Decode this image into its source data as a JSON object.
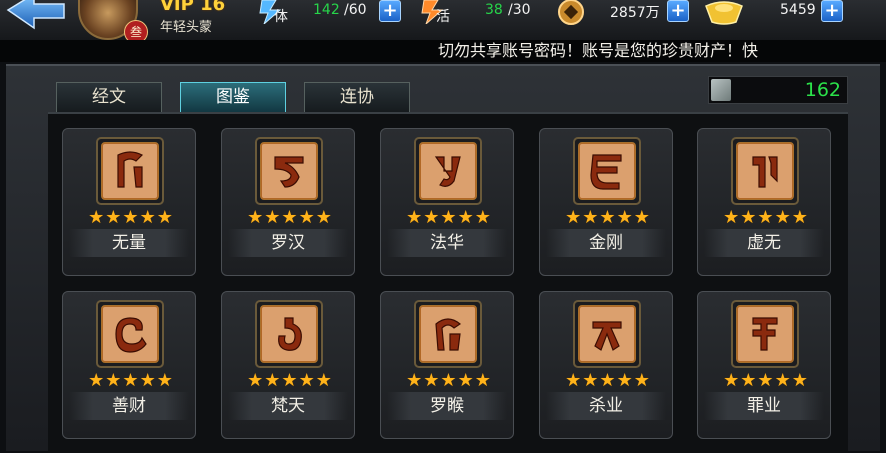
{
  "player": {
    "vip": "VIP 16",
    "title": "年轻头蒙",
    "rank_badge": "叁"
  },
  "resources": {
    "stamina_label": "体",
    "stamina": "142",
    "stamina_max": "/60",
    "vitality_label": "活",
    "vitality": "38",
    "vitality_max": "/30",
    "coins": "2857万",
    "gold": "5459"
  },
  "notice": "切勿共享账号密码！账号是您的珍贵财产！快",
  "tabs": [
    {
      "label": "经文",
      "active": false
    },
    {
      "label": "图鉴",
      "active": true
    },
    {
      "label": "连协",
      "active": false
    }
  ],
  "counter": {
    "value": "162"
  },
  "stars_text": "★★★★★",
  "cards": [
    {
      "name": "无量",
      "stars": 5,
      "icon": "sanskrit-sigil-icon"
    },
    {
      "name": "罗汉",
      "stars": 5,
      "icon": "sanskrit-sigil-icon"
    },
    {
      "name": "法华",
      "stars": 5,
      "icon": "sanskrit-sigil-icon"
    },
    {
      "name": "金刚",
      "stars": 5,
      "icon": "sanskrit-sigil-icon"
    },
    {
      "name": "虚无",
      "stars": 5,
      "icon": "sanskrit-sigil-icon"
    },
    {
      "name": "善财",
      "stars": 5,
      "icon": "sanskrit-sigil-icon"
    },
    {
      "name": "梵天",
      "stars": 5,
      "icon": "sanskrit-sigil-icon"
    },
    {
      "name": "罗睺",
      "stars": 5,
      "icon": "sanskrit-sigil-icon"
    },
    {
      "name": "杀业",
      "stars": 5,
      "icon": "sanskrit-sigil-icon"
    },
    {
      "name": "罪业",
      "stars": 5,
      "icon": "sanskrit-sigil-icon"
    }
  ],
  "colors": {
    "accent_green": "#27d54a",
    "star": "#ffb31a",
    "active_tab": "#2c6d7a"
  }
}
